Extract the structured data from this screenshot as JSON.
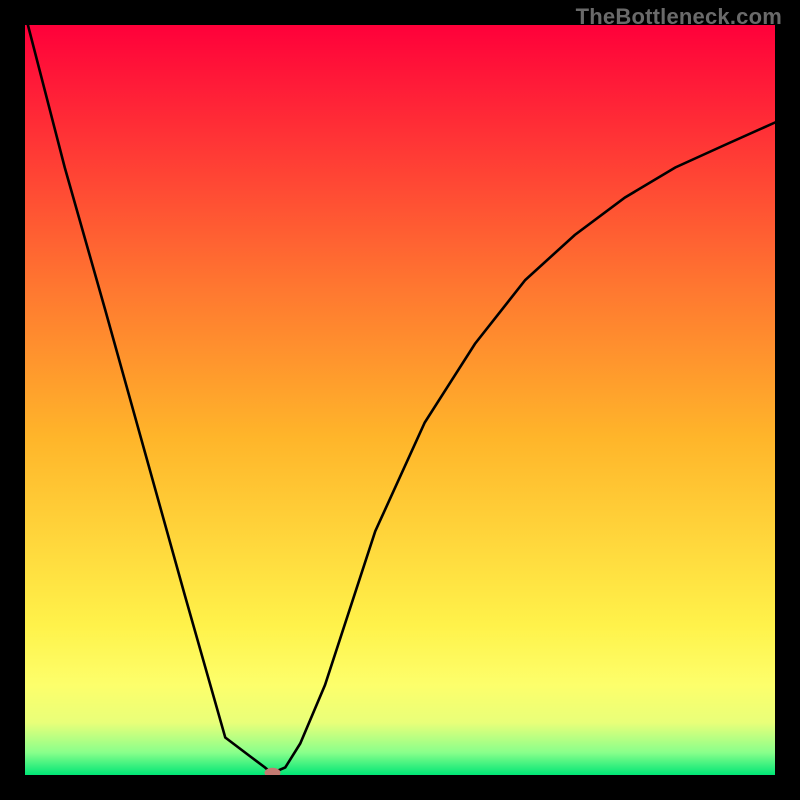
{
  "watermark": "TheBottleneck.com",
  "chart_data": {
    "type": "line",
    "title": "",
    "xlabel": "",
    "ylabel": "",
    "xlim": [
      0.0,
      1.0
    ],
    "ylim": [
      0.0,
      1.0
    ],
    "series": [
      {
        "name": "bottleneck-curve",
        "x": [
          0.0,
          0.053,
          0.107,
          0.16,
          0.213,
          0.267,
          0.3,
          0.32,
          0.327,
          0.333,
          0.347,
          0.367,
          0.4,
          0.467,
          0.533,
          0.6,
          0.667,
          0.733,
          0.8,
          0.867,
          0.933,
          1.0
        ],
        "y": [
          1.015,
          0.81,
          0.62,
          0.43,
          0.24,
          0.05,
          0.025,
          0.01,
          0.004,
          0.004,
          0.01,
          0.042,
          0.12,
          0.325,
          0.47,
          0.575,
          0.66,
          0.72,
          0.77,
          0.81,
          0.84,
          0.87
        ]
      }
    ],
    "marker": {
      "name": "minimum-marker",
      "x": 0.33,
      "y": 0.003,
      "color": "#c47a72"
    },
    "background_gradient": {
      "type": "vertical_linear",
      "stops": [
        {
          "position": 0.0,
          "color": "#ff003a"
        },
        {
          "position": 0.35,
          "color": "#ff7730"
        },
        {
          "position": 0.55,
          "color": "#ffb52a"
        },
        {
          "position": 0.8,
          "color": "#fff24a"
        },
        {
          "position": 0.88,
          "color": "#fdff6b"
        },
        {
          "position": 0.93,
          "color": "#e9ff79"
        },
        {
          "position": 0.97,
          "color": "#89ff8b"
        },
        {
          "position": 1.0,
          "color": "#00e676"
        }
      ]
    }
  }
}
